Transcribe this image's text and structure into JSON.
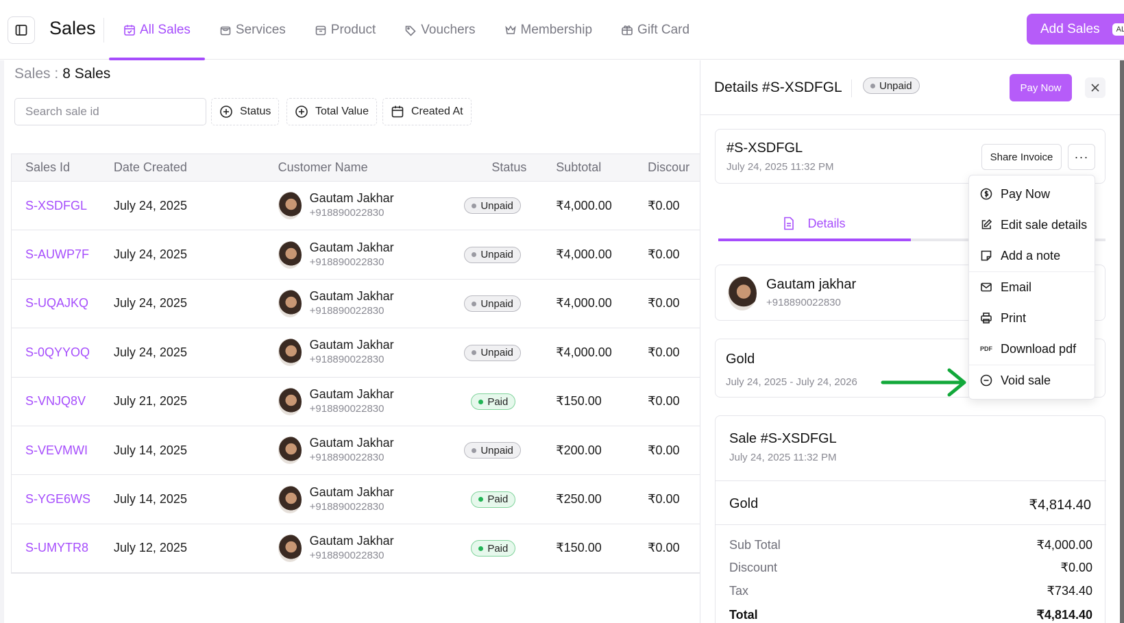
{
  "header": {
    "title": "Sales",
    "tabs": [
      {
        "label": "All Sales",
        "icon": "calendar-check-icon",
        "active": true
      },
      {
        "label": "Services",
        "icon": "bag-icon"
      },
      {
        "label": "Product",
        "icon": "box-icon"
      },
      {
        "label": "Vouchers",
        "icon": "tag-icon"
      },
      {
        "label": "Membership",
        "icon": "crown-icon"
      },
      {
        "label": "Gift Card",
        "icon": "gift-icon"
      }
    ],
    "add_button": "Add Sales",
    "add_shortcut": "AL"
  },
  "list": {
    "count_label": "Sales :",
    "count_value": "8 Sales",
    "search_placeholder": "Search sale id",
    "filters": [
      "Status",
      "Total Value",
      "Created At"
    ],
    "columns": [
      "Sales Id",
      "Date Created",
      "Customer Name",
      "Status",
      "Subtotal",
      "Discour"
    ],
    "rows": [
      {
        "id": "S-XSDFGL",
        "date": "July 24, 2025",
        "name": "Gautam Jakhar",
        "phone": "+918890022830",
        "status": "Unpaid",
        "subtotal": "₹4,000.00",
        "discount": "₹0.00"
      },
      {
        "id": "S-AUWP7F",
        "date": "July 24, 2025",
        "name": "Gautam Jakhar",
        "phone": "+918890022830",
        "status": "Unpaid",
        "subtotal": "₹4,000.00",
        "discount": "₹0.00"
      },
      {
        "id": "S-UQAJKQ",
        "date": "July 24, 2025",
        "name": "Gautam Jakhar",
        "phone": "+918890022830",
        "status": "Unpaid",
        "subtotal": "₹4,000.00",
        "discount": "₹0.00"
      },
      {
        "id": "S-0QYYOQ",
        "date": "July 24, 2025",
        "name": "Gautam Jakhar",
        "phone": "+918890022830",
        "status": "Unpaid",
        "subtotal": "₹4,000.00",
        "discount": "₹0.00"
      },
      {
        "id": "S-VNJQ8V",
        "date": "July 21, 2025",
        "name": "Gautam Jakhar",
        "phone": "+918890022830",
        "status": "Paid",
        "subtotal": "₹150.00",
        "discount": "₹0.00"
      },
      {
        "id": "S-VEVMWI",
        "date": "July 14, 2025",
        "name": "Gautam Jakhar",
        "phone": "+918890022830",
        "status": "Unpaid",
        "subtotal": "₹200.00",
        "discount": "₹0.00"
      },
      {
        "id": "S-YGE6WS",
        "date": "July 14, 2025",
        "name": "Gautam Jakhar",
        "phone": "+918890022830",
        "status": "Paid",
        "subtotal": "₹250.00",
        "discount": "₹0.00"
      },
      {
        "id": "S-UMYTR8",
        "date": "July 12, 2025",
        "name": "Gautam Jakhar",
        "phone": "+918890022830",
        "status": "Paid",
        "subtotal": "₹150.00",
        "discount": "₹0.00"
      }
    ]
  },
  "details": {
    "title": "Details #S-XSDFGL",
    "status": "Unpaid",
    "pay_now": "Pay Now",
    "invoice_id": "#S-XSDFGL",
    "invoice_date": "July 24, 2025 11:32 PM",
    "share_invoice": "Share Invoice",
    "more": "···",
    "tab_details": "Details",
    "customer_name": "Gautam jakhar",
    "customer_phone": "+918890022830",
    "membership_name": "Gold",
    "membership_range": "July 24, 2025 - July 24, 2026",
    "sale_title": "Sale #S-XSDFGL",
    "sale_date": "July 24, 2025 11:32 PM",
    "item_name": "Gold",
    "item_amount": "₹4,814.40",
    "summary": [
      {
        "label": "Sub Total",
        "value": "₹4,000.00"
      },
      {
        "label": "Discount",
        "value": "₹0.00"
      },
      {
        "label": "Tax",
        "value": "₹734.40"
      },
      {
        "label": "Total",
        "value": "₹4,814.40"
      }
    ]
  },
  "menu": {
    "items": [
      {
        "label": "Pay Now",
        "icon": "dollar-circle-icon"
      },
      {
        "label": "Edit sale details",
        "icon": "edit-icon"
      },
      {
        "label": "Add a note",
        "icon": "note-icon"
      },
      {
        "label": "Email",
        "icon": "mail-icon"
      },
      {
        "label": "Print",
        "icon": "printer-icon"
      },
      {
        "label": "Download pdf",
        "icon": "pdf-icon",
        "icon_text": "PDF"
      },
      {
        "label": "Void sale",
        "icon": "minus-circle-icon"
      }
    ]
  },
  "colors": {
    "accent": "#a64dfc",
    "button": "#b65cf9",
    "paid": "#22b455",
    "arrow": "#12a83a"
  }
}
